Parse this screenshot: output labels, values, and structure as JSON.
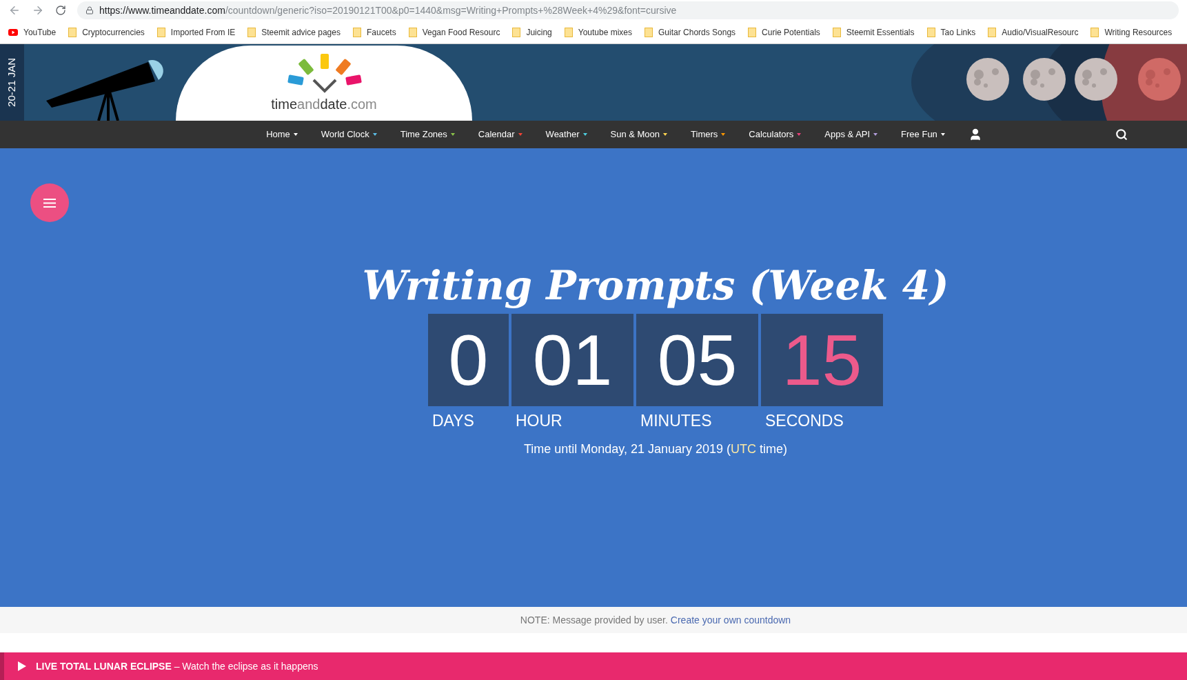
{
  "browser": {
    "url_host": "https://www.timeanddate.com",
    "url_path": "/countdown/generic?iso=20190121T00&p0=1440&msg=Writing+Prompts+%28Week+4%29&font=cursive"
  },
  "bookmarks": [
    {
      "kind": "youtube",
      "label": "YouTube"
    },
    {
      "kind": "folder",
      "label": "Cryptocurrencies"
    },
    {
      "kind": "folder",
      "label": "Imported From IE"
    },
    {
      "kind": "folder",
      "label": "Steemit advice pages"
    },
    {
      "kind": "folder",
      "label": "Faucets"
    },
    {
      "kind": "folder",
      "label": "Vegan Food Resourc"
    },
    {
      "kind": "folder",
      "label": "Juicing"
    },
    {
      "kind": "folder",
      "label": "Youtube mixes"
    },
    {
      "kind": "folder",
      "label": "Guitar Chords Songs"
    },
    {
      "kind": "folder",
      "label": "Curie Potentials"
    },
    {
      "kind": "folder",
      "label": "Steemit Essentials"
    },
    {
      "kind": "folder",
      "label": "Tao Links"
    },
    {
      "kind": "folder",
      "label": "Audio/VisualResourc"
    },
    {
      "kind": "folder",
      "label": "Writing Resources"
    }
  ],
  "header": {
    "date_banner": "20-21 JAN",
    "logo": {
      "part_1": "time",
      "part_2": "and",
      "part_3": "date",
      "part_4": ".com"
    }
  },
  "nav": [
    {
      "label": "Home",
      "color": "#ffffff"
    },
    {
      "label": "World Clock",
      "color": "#5bc0eb"
    },
    {
      "label": "Time Zones",
      "color": "#8bc34a"
    },
    {
      "label": "Calendar",
      "color": "#f44336"
    },
    {
      "label": "Weather",
      "color": "#4dd0e1"
    },
    {
      "label": "Sun & Moon",
      "color": "#ffd54f"
    },
    {
      "label": "Timers",
      "color": "#ff9800"
    },
    {
      "label": "Calculators",
      "color": "#ec407a"
    },
    {
      "label": "Apps & API",
      "color": "#b39ddb"
    },
    {
      "label": "Free Fun",
      "color": "#ffffff"
    }
  ],
  "countdown": {
    "title": "Writing Prompts (Week 4)",
    "units": [
      {
        "value": "0",
        "label": "DAYS",
        "color": "#ffffff"
      },
      {
        "value": "01",
        "label": "HOUR",
        "color": "#ffffff"
      },
      {
        "value": "05",
        "label": "MINUTES",
        "color": "#ffffff"
      },
      {
        "value": "15",
        "label": "SECONDS",
        "color": "#ec5a8b"
      }
    ],
    "until_prefix": "Time until Monday, 21 January 2019 (",
    "until_link": "UTC",
    "until_suffix": " time)"
  },
  "note": {
    "text": "NOTE: Message provided by user.",
    "link": "Create your own countdown"
  },
  "banner": {
    "text": "**LIVE TOTAL LUNAR ECLIPSE** – Watch the eclipse as it happens"
  }
}
